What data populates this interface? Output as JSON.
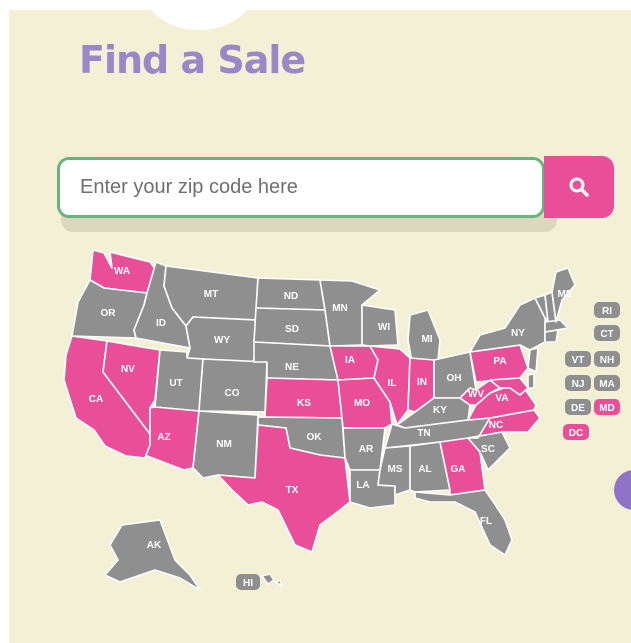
{
  "title": "Find a Sale",
  "search": {
    "placeholder": "Enter your zip code here"
  },
  "colors": {
    "active": "#e84f98",
    "inactive": "#8f8f8f",
    "background": "#f3f0d6",
    "title": "#9b86c8",
    "search_border": "#69b37d"
  },
  "icons": {
    "search_button": "search-icon"
  },
  "states": {
    "WA": {
      "label": "WA",
      "active": true
    },
    "OR": {
      "label": "OR",
      "active": false
    },
    "CA": {
      "label": "CA",
      "active": true
    },
    "ID": {
      "label": "ID",
      "active": false
    },
    "NV": {
      "label": "NV",
      "active": true
    },
    "MT": {
      "label": "MT",
      "active": false
    },
    "WY": {
      "label": "WY",
      "active": false
    },
    "UT": {
      "label": "UT",
      "active": false
    },
    "AZ": {
      "label": "AZ",
      "active": true
    },
    "CO": {
      "label": "CO",
      "active": false
    },
    "NM": {
      "label": "NM",
      "active": false
    },
    "ND": {
      "label": "ND",
      "active": false
    },
    "SD": {
      "label": "SD",
      "active": false
    },
    "NE": {
      "label": "NE",
      "active": false
    },
    "KS": {
      "label": "KS",
      "active": true
    },
    "OK": {
      "label": "OK",
      "active": false
    },
    "TX": {
      "label": "TX",
      "active": true
    },
    "MN": {
      "label": "MN",
      "active": false
    },
    "IA": {
      "label": "IA",
      "active": true
    },
    "MO": {
      "label": "MO",
      "active": true
    },
    "AR": {
      "label": "AR",
      "active": false
    },
    "LA": {
      "label": "LA",
      "active": false
    },
    "WI": {
      "label": "WI",
      "active": false
    },
    "IL": {
      "label": "IL",
      "active": true
    },
    "MI": {
      "label": "MI",
      "active": false
    },
    "IN": {
      "label": "IN",
      "active": true
    },
    "OH": {
      "label": "OH",
      "active": false
    },
    "KY": {
      "label": "KY",
      "active": false
    },
    "TN": {
      "label": "TN",
      "active": false
    },
    "MS": {
      "label": "MS",
      "active": false
    },
    "AL": {
      "label": "AL",
      "active": false
    },
    "GA": {
      "label": "GA",
      "active": true
    },
    "FL": {
      "label": "FL",
      "active": false
    },
    "SC": {
      "label": "SC",
      "active": false
    },
    "NC": {
      "label": "NC",
      "active": true
    },
    "VA": {
      "label": "VA",
      "active": true
    },
    "WV": {
      "label": "WV",
      "active": true
    },
    "PA": {
      "label": "PA",
      "active": true
    },
    "NY": {
      "label": "NY",
      "active": false
    },
    "ME": {
      "label": "ME",
      "active": false
    },
    "AK": {
      "label": "AK",
      "active": false
    },
    "HI": {
      "label": "HI",
      "active": false
    }
  },
  "small_states": [
    {
      "label": "RI",
      "active": false
    },
    {
      "label": "CT",
      "active": false
    },
    {
      "label": "VT",
      "active": false
    },
    {
      "label": "NH",
      "active": false
    },
    {
      "label": "NJ",
      "active": false
    },
    {
      "label": "MA",
      "active": false
    },
    {
      "label": "DE",
      "active": false
    },
    {
      "label": "MD",
      "active": true
    },
    {
      "label": "DC",
      "active": true
    }
  ]
}
